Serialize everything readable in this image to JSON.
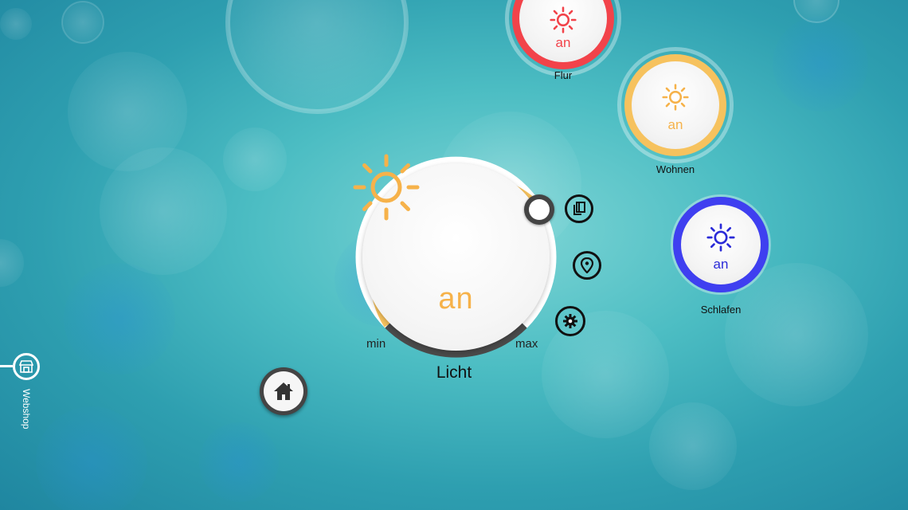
{
  "main_control": {
    "title": "Licht",
    "value": "an",
    "min_label": "min",
    "max_label": "max",
    "level_percent": 100,
    "accent_color": "#f6b24a"
  },
  "actions": [
    {
      "name": "copy",
      "icon": "copy-icon"
    },
    {
      "name": "location",
      "icon": "location-pin-icon"
    },
    {
      "name": "settings",
      "icon": "gear-icon"
    }
  ],
  "devices": [
    {
      "label": "Flur",
      "value": "an",
      "color": "#f2434a"
    },
    {
      "label": "Wohnen",
      "value": "an",
      "color": "#f6b24a"
    },
    {
      "label": "Schlafen",
      "value": "an",
      "color": "#3f3ff0"
    }
  ],
  "home": {
    "icon": "home-icon"
  },
  "side_tab": {
    "label": "Webshop",
    "icon": "shop-icon"
  }
}
